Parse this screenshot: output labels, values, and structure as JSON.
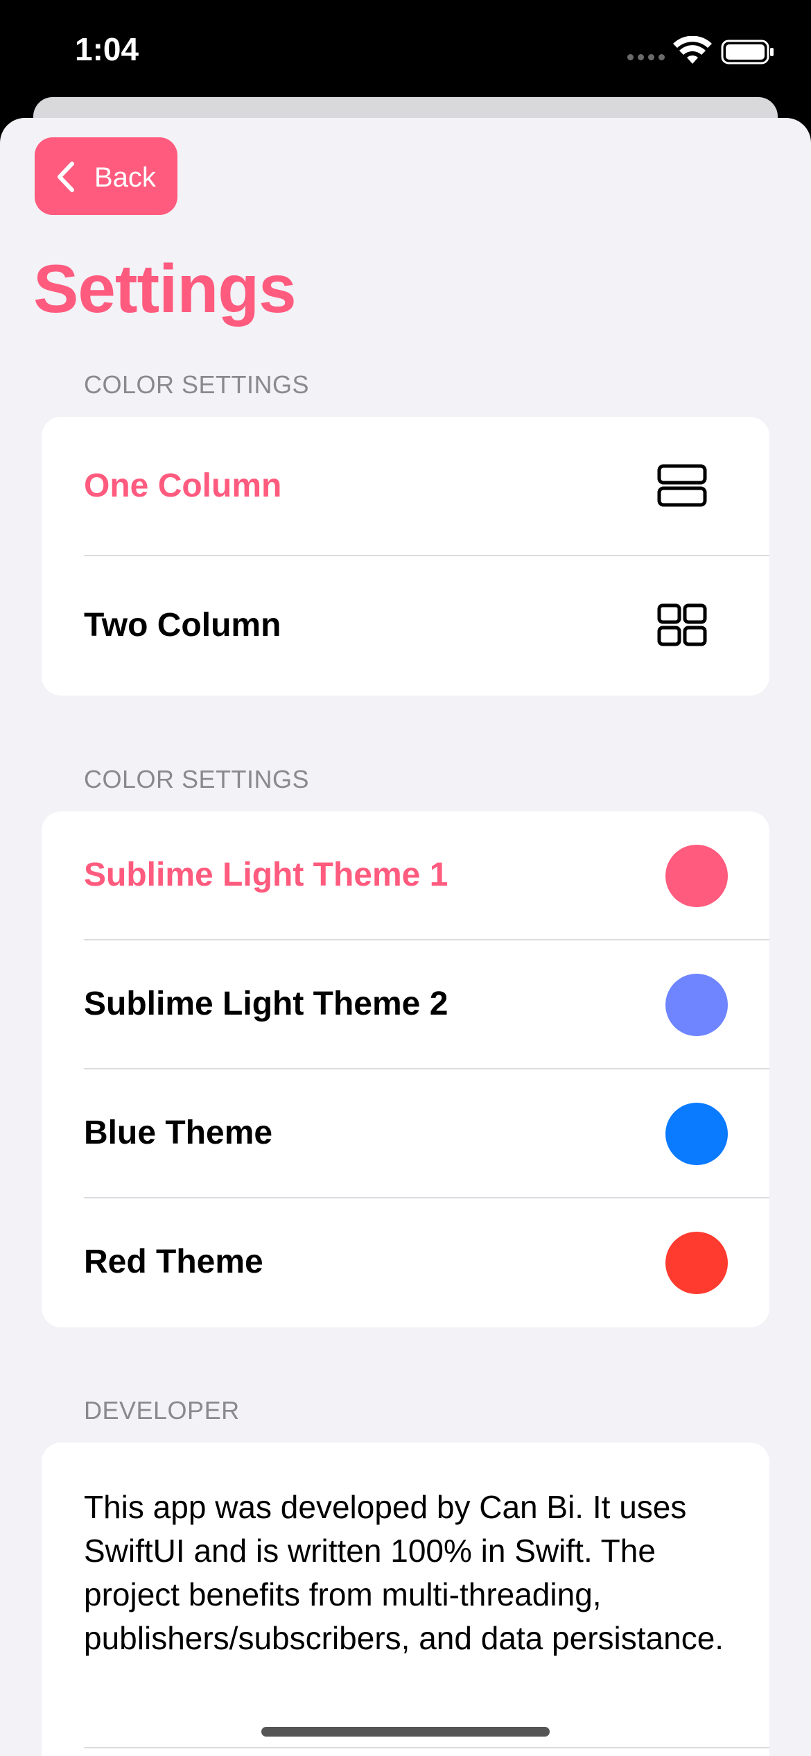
{
  "status_bar": {
    "time": "1:04"
  },
  "nav": {
    "back_label": "Back",
    "title": "Settings"
  },
  "sections": {
    "layout": {
      "header": "COLOR SETTINGS",
      "rows": [
        {
          "label": "One Column",
          "icon": "one-column-layout-icon",
          "selected": true
        },
        {
          "label": "Two Column",
          "icon": "two-column-grid-icon",
          "selected": false
        }
      ]
    },
    "themes": {
      "header": "COLOR SETTINGS",
      "rows": [
        {
          "label": "Sublime Light Theme 1",
          "color": "#ff5b7e",
          "selected": true
        },
        {
          "label": "Sublime Light Theme 2",
          "color": "#6e85ff",
          "selected": false
        },
        {
          "label": "Blue Theme",
          "color": "#0a7aff",
          "selected": false
        },
        {
          "label": "Red Theme",
          "color": "#ff3b30",
          "selected": false
        }
      ]
    },
    "developer": {
      "header": "DEVELOPER",
      "text": "This app was developed by Can Bi. It uses SwiftUI and is written 100% in Swift. The project benefits from multi-threading, publishers/subscribers, and data persistance."
    }
  },
  "colors": {
    "accent": "#ff5b7e",
    "background": "#f2f2f7"
  }
}
